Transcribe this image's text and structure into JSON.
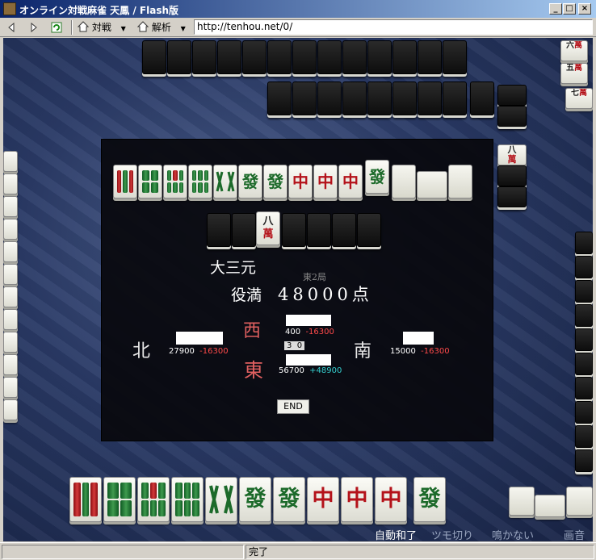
{
  "window": {
    "title": "オンライン対戦麻雀 天鳳 / Flash版",
    "minimize": "_",
    "maximize": "□",
    "close": "×"
  },
  "toolbar": {
    "match_label": "対戦",
    "analysis_label": "解析",
    "url": "http://tenhou.net/0/"
  },
  "result": {
    "yaku": "大三元",
    "limit": "役満",
    "points": "48000点",
    "round": "東2局",
    "end_button": "END"
  },
  "seats": {
    "north": {
      "wind": "北",
      "score": "27900",
      "delta": "-16300"
    },
    "west": {
      "wind": "西",
      "score": "400",
      "delta": "-16300"
    },
    "south": {
      "wind": "南",
      "score": "15000",
      "delta": "-16300"
    },
    "east": {
      "wind": "東",
      "score": "56700",
      "delta": "+48900"
    }
  },
  "counters": {
    "honba": "3",
    "riichi": "0"
  },
  "options": {
    "auto_win": "自動和了",
    "tsumogiri": "ツモ切り",
    "no_call": "鳴かない",
    "sound": "画音"
  },
  "status": {
    "text": "完了"
  },
  "colors": {
    "red_dragon": "#b4121a",
    "green_dragon": "#1c6a2a",
    "negative": "#ff4a4a",
    "positive": "#36d0d0"
  }
}
